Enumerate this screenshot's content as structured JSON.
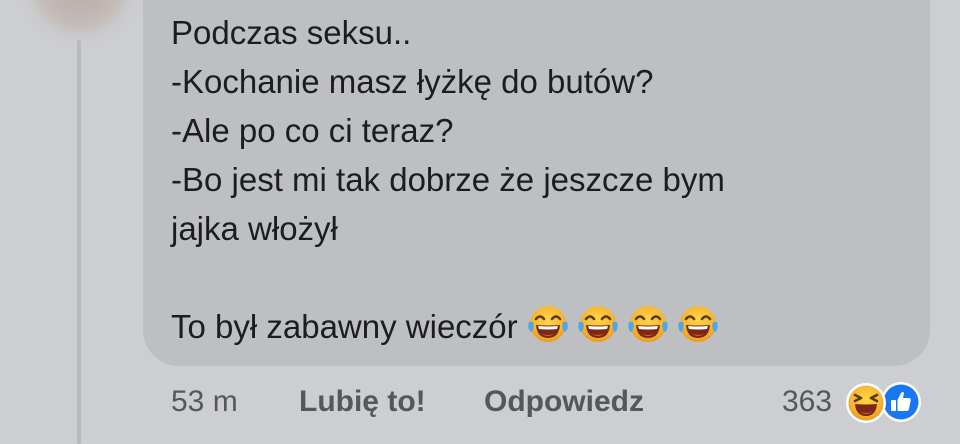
{
  "comment": {
    "lines": [
      "Podczas seksu..",
      "-Kochanie masz łyżkę do butów?",
      "-Ale po co ci teraz?",
      "-Bo jest mi tak dobrze że jeszcze bym",
      "jajka włożył"
    ],
    "closing_line": "To był zabawny wieczór",
    "closing_emojis": [
      "tears-of-joy-emoji",
      "tears-of-joy-emoji",
      "tears-of-joy-emoji",
      "tears-of-joy-emoji"
    ]
  },
  "actions": {
    "time": "53 m",
    "like_label": "Lubię to!",
    "reply_label": "Odpowiedz"
  },
  "reactions": {
    "count": "363",
    "icons": [
      "haha-reaction-icon",
      "like-reaction-icon"
    ],
    "like_color": "#1877f2"
  },
  "colors": {
    "background": "#cdced2",
    "bubble": "#bebfc3",
    "text": "#1c1d20",
    "meta_text": "#55575c"
  }
}
